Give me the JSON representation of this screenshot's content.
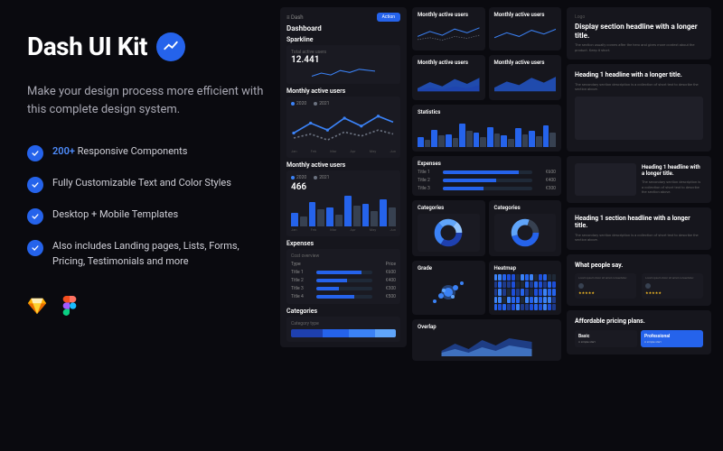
{
  "hero": {
    "title": "Dash UI Kit",
    "subtitle": "Make your design process more efficient with this complete design system."
  },
  "features": {
    "f1_highlight": "200+",
    "f1_rest": " Responsive Components",
    "f2": "Fully Customizable Text and Color Styles",
    "f3": "Desktop + Mobile Templates",
    "f4": "Also includes Landing pages, Lists, Forms, Pricing, Testimonials and more"
  },
  "preview": {
    "app_name": "Dash",
    "action_label": "Action",
    "dashboard_title": "Dashboard",
    "sparkline_label": "Sparkline",
    "sparkline_metric": "Total active users",
    "sparkline_value": "12.441",
    "mau_title": "Monthly active users",
    "mau_stat": "466",
    "legend_y1": "2020",
    "legend_y2": "2021",
    "months": [
      "Jan",
      "Feb",
      "Mar",
      "Apr",
      "May",
      "Jun"
    ],
    "expenses_title": "Expenses",
    "cost_overview": "Cost overview",
    "type_label": "Type",
    "price_label": "Price",
    "exp_rows": [
      {
        "label": "Title 1",
        "val": "€600"
      },
      {
        "label": "Title 2",
        "val": "€400"
      },
      {
        "label": "Title 3",
        "val": "€300"
      },
      {
        "label": "Title 4",
        "val": "€500"
      }
    ],
    "categories_title": "Categories",
    "category_type": "Category type",
    "statistics_title": "Statistics",
    "grade_title": "Grade",
    "heatmap_title": "Heatmap",
    "overlap_title": "Overlap"
  },
  "landing": {
    "brand": "Logo",
    "hero_title": "Display section headline with a longer title.",
    "hero_sub": "The section usually comes after the hero and gives more context about the product. Keep it short.",
    "h1": "Heading 1 headline with a longer title.",
    "h1_sub": "The secondary section description is a collection of short text to describe the section above.",
    "h1b": "Heading 1 section headline with a longer title.",
    "testimonials_title": "What people say.",
    "pricing_title": "Affordable pricing plans.",
    "plan_basic": "Basic",
    "plan_pro": "Professional",
    "plan_desc": "A simple start"
  },
  "colors": {
    "accent": "#2563eb",
    "accent_light": "#4f8eff"
  }
}
